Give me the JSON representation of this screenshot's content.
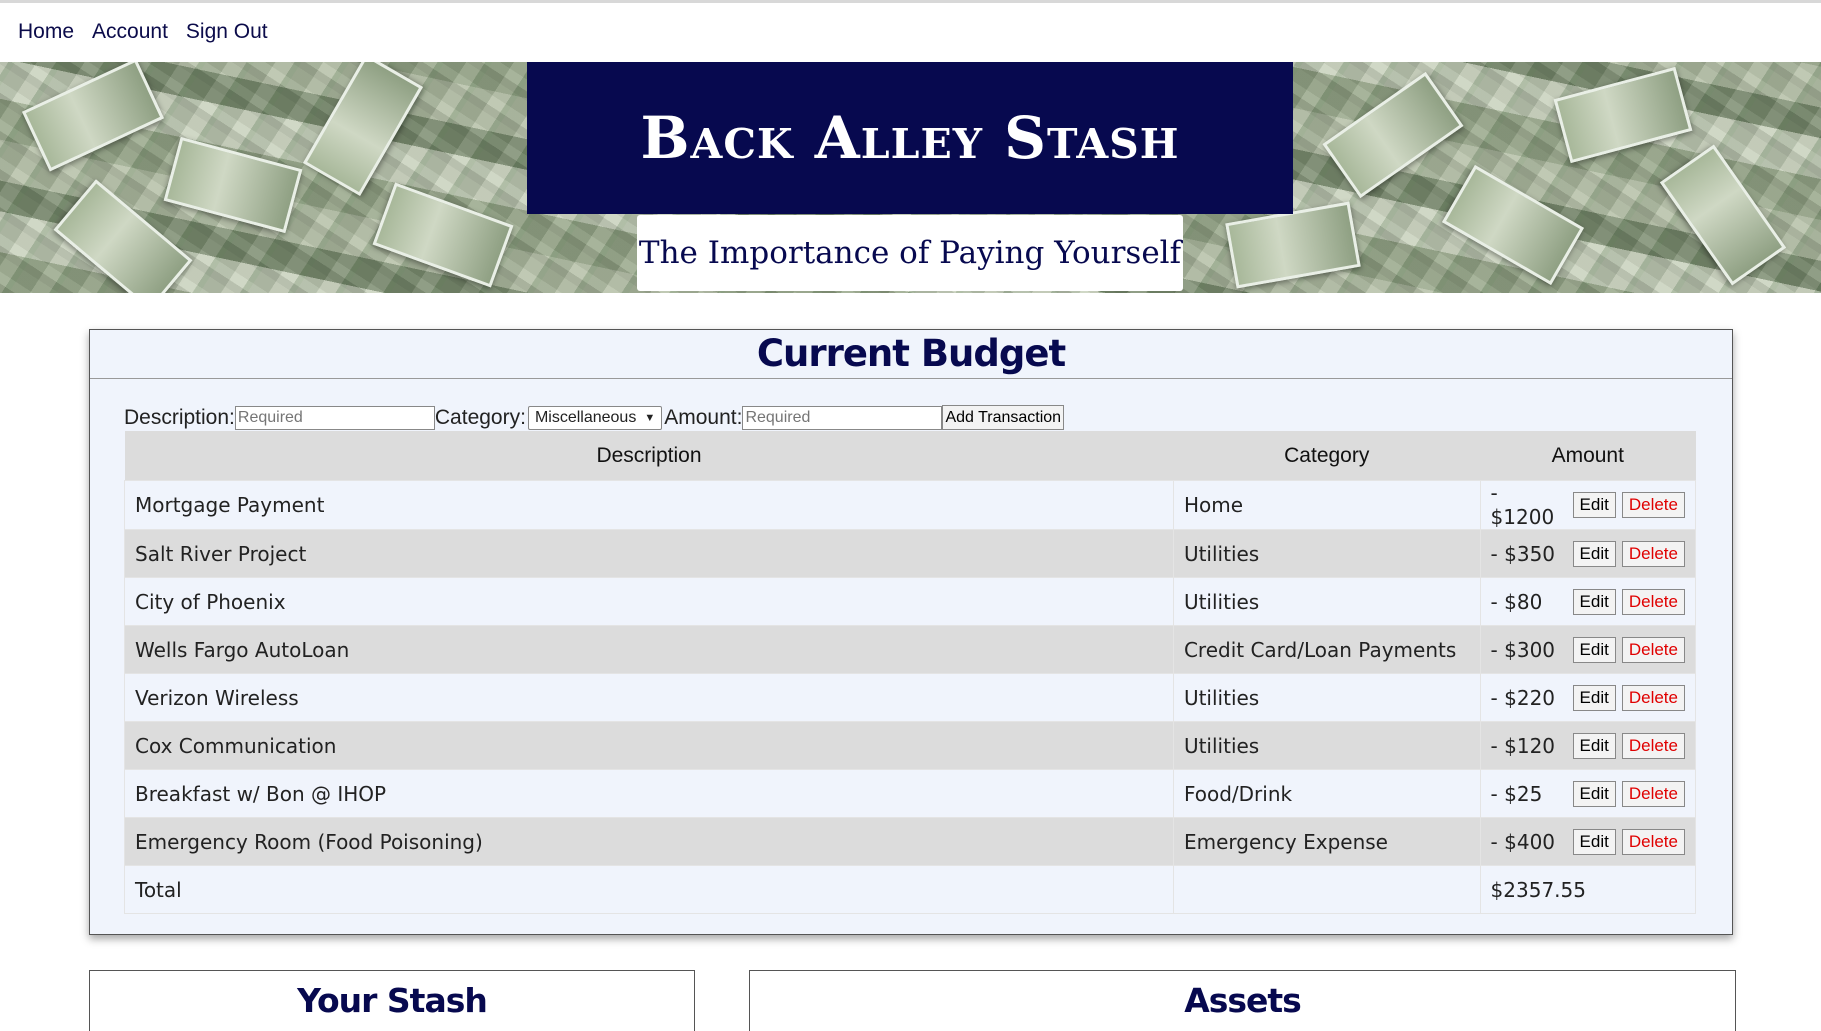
{
  "nav": {
    "home": "Home",
    "account": "Account",
    "sign_out": "Sign Out"
  },
  "header": {
    "title": "Back Alley Stash",
    "subtitle": "The Importance of Paying Yourself"
  },
  "budget": {
    "title": "Current Budget",
    "form": {
      "description_label": "Description:",
      "description_placeholder": "Required",
      "category_label": "Category:",
      "category_selected": "Miscellaneous",
      "amount_label": "Amount:",
      "amount_placeholder": "Required",
      "add_button": "Add Transaction"
    },
    "columns": [
      "Description",
      "Category",
      "Amount"
    ],
    "rows": [
      {
        "description": "Mortgage Payment",
        "category": "Home",
        "amount": "- $1200"
      },
      {
        "description": "Salt River Project",
        "category": "Utilities",
        "amount": "- $350"
      },
      {
        "description": "City of Phoenix",
        "category": "Utilities",
        "amount": "- $80"
      },
      {
        "description": "Wells Fargo AutoLoan",
        "category": "Credit Card/Loan Payments",
        "amount": "- $300"
      },
      {
        "description": "Verizon Wireless",
        "category": "Utilities",
        "amount": "- $220"
      },
      {
        "description": "Cox Communication",
        "category": "Utilities",
        "amount": "- $120"
      },
      {
        "description": "Breakfast w/ Bon @ IHOP",
        "category": "Food/Drink",
        "amount": "- $25"
      },
      {
        "description": "Emergency Room (Food Poisoning)",
        "category": "Emergency Expense",
        "amount": "- $400"
      }
    ],
    "edit_label": "Edit",
    "delete_label": "Delete",
    "total_label": "Total",
    "total_value": "$2357.55"
  },
  "stash": {
    "title": "Your Stash"
  },
  "assets": {
    "title": "Assets"
  },
  "colors": {
    "navy": "#07094f",
    "delete_red": "#e00000",
    "row_gray": "#dcdcdc",
    "panel_bg": "#f0f4fc"
  }
}
